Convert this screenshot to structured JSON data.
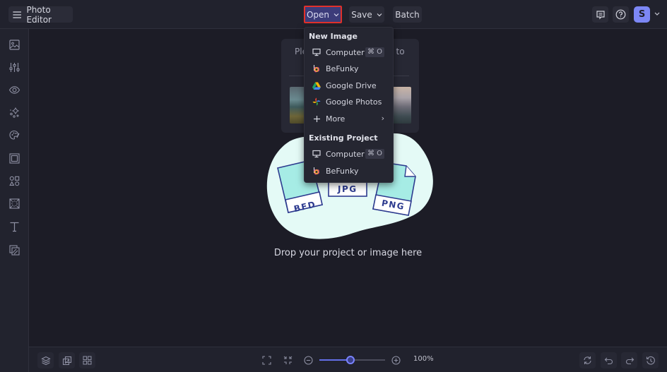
{
  "header": {
    "app_title": "Photo Editor",
    "open_label": "Open",
    "save_label": "Save",
    "batch_label": "Batch",
    "avatar_initial": "S"
  },
  "sidebar": {
    "items": [
      {
        "name": "image-manager-icon"
      },
      {
        "name": "edit-adjustments-icon"
      },
      {
        "name": "touch-up-icon"
      },
      {
        "name": "effects-icon"
      },
      {
        "name": "artsy-icon"
      },
      {
        "name": "frames-icon"
      },
      {
        "name": "graphics-icon"
      },
      {
        "name": "overlays-icon"
      },
      {
        "name": "text-icon"
      },
      {
        "name": "textures-icon"
      }
    ]
  },
  "open_menu": {
    "new_image_heading": "New Image",
    "new_image_items": [
      {
        "label": "Computer",
        "icon": "monitor-icon",
        "shortcut": "⌘ O"
      },
      {
        "label": "BeFunky",
        "icon": "befunky-icon"
      },
      {
        "label": "Google Drive",
        "icon": "google-drive-icon"
      },
      {
        "label": "Google Photos",
        "icon": "google-photos-icon"
      },
      {
        "label": "More",
        "icon": "plus-icon",
        "submenu": "›"
      }
    ],
    "existing_project_heading": "Existing Project",
    "existing_project_items": [
      {
        "label": "Computer",
        "icon": "monitor-icon",
        "shortcut": "⌘ O"
      },
      {
        "label": "BeFunky",
        "icon": "befunky-icon"
      }
    ]
  },
  "sample_panel": {
    "text_left": "Ple",
    "text_right": "t to"
  },
  "illustration": {
    "file_labels": [
      "BFD",
      "JPG",
      "PNG"
    ]
  },
  "canvas": {
    "drop_text": "Drop your project or image here"
  },
  "bottom_bar": {
    "zoom_level": "100%",
    "zoom_slider_fraction": 0.47
  },
  "colors": {
    "accent": "#7c87f5",
    "open_highlight_border": "#e2312b",
    "background": "#1d1d27",
    "blob": "#e6fbf7",
    "file_teal": "#a3ede6",
    "file_outline": "#2b3a8c"
  }
}
